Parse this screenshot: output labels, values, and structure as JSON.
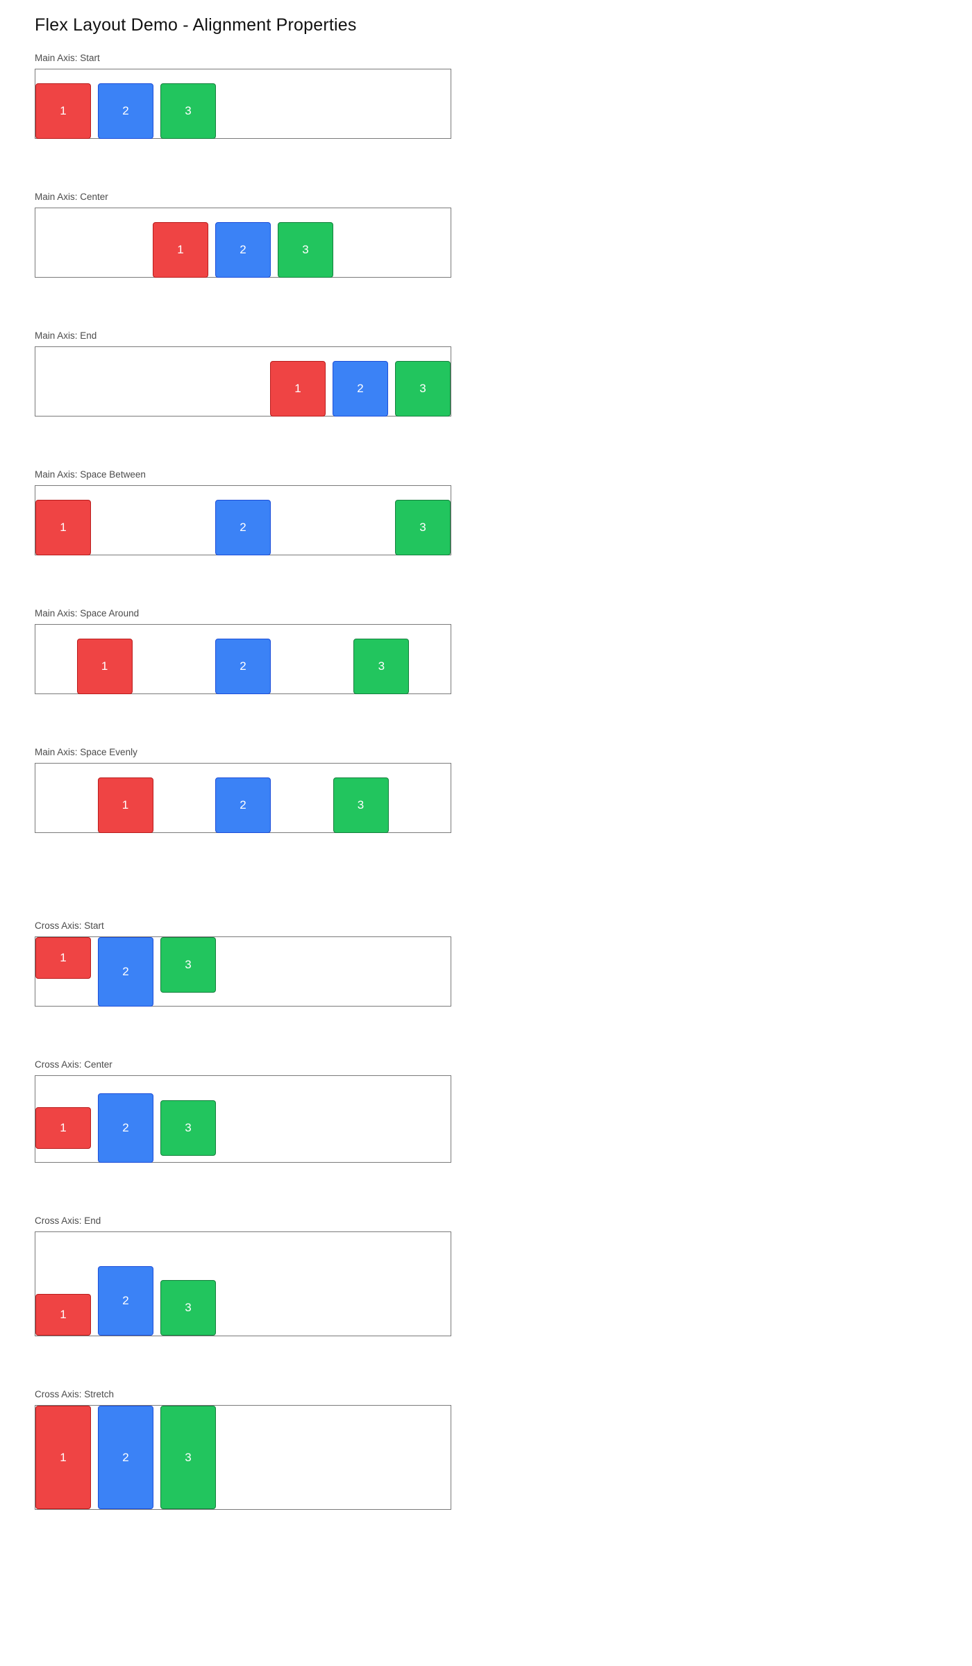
{
  "page": {
    "title": "Flex Layout Demo - Alignment Properties"
  },
  "colors": {
    "item_1": "#ef4444",
    "item_2": "#3b82f6",
    "item_3": "#22c55e",
    "box_border": "#7a7a7a"
  },
  "main_axis_demos": [
    {
      "label": "Main Axis: Start",
      "justify": "flex-start",
      "items": [
        "1",
        "2",
        "3"
      ]
    },
    {
      "label": "Main Axis: Center",
      "justify": "center",
      "items": [
        "1",
        "2",
        "3"
      ]
    },
    {
      "label": "Main Axis: End",
      "justify": "flex-end",
      "items": [
        "1",
        "2",
        "3"
      ]
    },
    {
      "label": "Main Axis: Space Between",
      "justify": "space-between",
      "items": [
        "1",
        "2",
        "3"
      ]
    },
    {
      "label": "Main Axis: Space Around",
      "justify": "space-around",
      "items": [
        "1",
        "2",
        "3"
      ]
    },
    {
      "label": "Main Axis: Space Evenly",
      "justify": "space-evenly",
      "items": [
        "1",
        "2",
        "3"
      ]
    }
  ],
  "cross_axis_demos": [
    {
      "label": "Cross Axis: Start",
      "align": "flex-start",
      "items": [
        "1",
        "2",
        "3"
      ]
    },
    {
      "label": "Cross Axis: Center",
      "align": "center",
      "items": [
        "1",
        "2",
        "3"
      ]
    },
    {
      "label": "Cross Axis: End",
      "align": "flex-end",
      "items": [
        "1",
        "2",
        "3"
      ]
    },
    {
      "label": "Cross Axis: Stretch",
      "align": "stretch",
      "items": [
        "1",
        "2",
        "3"
      ]
    }
  ]
}
